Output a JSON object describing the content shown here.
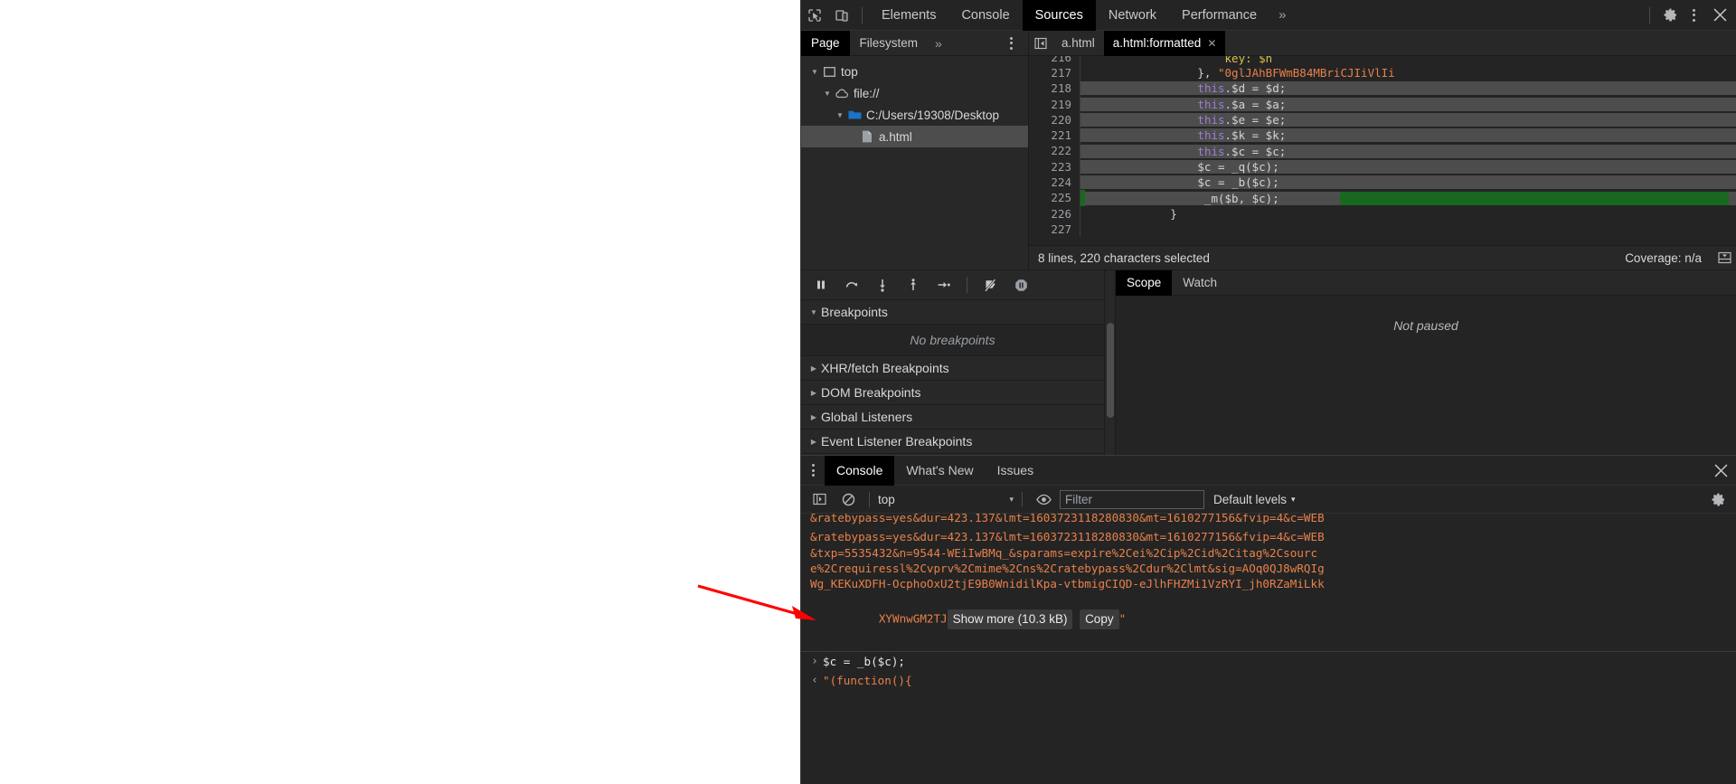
{
  "devtools": {
    "main_tabs": [
      {
        "label": "Elements",
        "active": false
      },
      {
        "label": "Console",
        "active": false
      },
      {
        "label": "Sources",
        "active": true
      },
      {
        "label": "Network",
        "active": false
      },
      {
        "label": "Performance",
        "active": false
      }
    ],
    "more_tabs_label": "»",
    "inspect_icon": "inspect-cursor-icon",
    "device_icon": "device-toolbar-icon",
    "settings_icon": "gear-icon",
    "menu_icon": "kebab-menu-icon",
    "close_icon": "close-icon"
  },
  "navigator": {
    "tabs": [
      {
        "label": "Page",
        "active": true
      },
      {
        "label": "Filesystem",
        "active": false
      }
    ],
    "more_label": "»",
    "tree": [
      {
        "label": "top",
        "icon": "frame-icon",
        "depth": 0,
        "expanded": true,
        "selected": false
      },
      {
        "label": "file://",
        "icon": "cloud-icon",
        "depth": 1,
        "expanded": true,
        "selected": false
      },
      {
        "label": "C:/Users/19308/Desktop",
        "icon": "folder-icon",
        "depth": 2,
        "expanded": true,
        "selected": false
      },
      {
        "label": "a.html",
        "icon": "file-icon",
        "depth": 3,
        "expanded": false,
        "selected": true
      }
    ]
  },
  "editor": {
    "back_icon": "navigate-back-icon",
    "tabs": [
      {
        "label": "a.html",
        "active": false,
        "closeable": false
      },
      {
        "label": "a.html:formatted",
        "active": true,
        "closeable": true
      }
    ],
    "close_icon": "close-icon",
    "lines": [
      {
        "num": "216",
        "partial": true,
        "selected": false,
        "segments": [
          {
            "t": "                    key: $n",
            "c": "tok-yel"
          }
        ]
      },
      {
        "num": "217",
        "selected": false,
        "green_tail": false,
        "segments": [
          {
            "t": "                }, ",
            "c": "tok-plain"
          },
          {
            "t": "\"0glJAhBFWmB84MBriCJIiVlIi",
            "c": "tok-str"
          }
        ]
      },
      {
        "num": "218",
        "selected": true,
        "green_tail": false,
        "segments": [
          {
            "t": "                ",
            "c": "tok-plain"
          },
          {
            "t": "this",
            "c": "tok-kw"
          },
          {
            "t": ".$d = $d;",
            "c": "tok-plain"
          }
        ]
      },
      {
        "num": "219",
        "selected": true,
        "green_tail": false,
        "segments": [
          {
            "t": "                ",
            "c": "tok-plain"
          },
          {
            "t": "this",
            "c": "tok-kw"
          },
          {
            "t": ".$a = $a;",
            "c": "tok-plain"
          }
        ]
      },
      {
        "num": "220",
        "selected": true,
        "green_tail": false,
        "segments": [
          {
            "t": "                ",
            "c": "tok-plain"
          },
          {
            "t": "this",
            "c": "tok-kw"
          },
          {
            "t": ".$e = $e;",
            "c": "tok-plain"
          }
        ]
      },
      {
        "num": "221",
        "selected": true,
        "green_tail": false,
        "segments": [
          {
            "t": "                ",
            "c": "tok-plain"
          },
          {
            "t": "this",
            "c": "tok-kw"
          },
          {
            "t": ".$k = $k;",
            "c": "tok-plain"
          }
        ]
      },
      {
        "num": "222",
        "selected": true,
        "green_tail": false,
        "segments": [
          {
            "t": "                ",
            "c": "tok-plain"
          },
          {
            "t": "this",
            "c": "tok-kw"
          },
          {
            "t": ".$c = $c;",
            "c": "tok-plain"
          }
        ]
      },
      {
        "num": "223",
        "selected": true,
        "green_tail": false,
        "segments": [
          {
            "t": "                $c = _q($c);",
            "c": "tok-plain"
          }
        ]
      },
      {
        "num": "224",
        "selected": true,
        "green_tail": false,
        "segments": [
          {
            "t": "                $c = _b($c);",
            "c": "tok-plain"
          }
        ]
      },
      {
        "num": "225",
        "selected": true,
        "green_tail": true,
        "breakpoint": true,
        "segments": [
          {
            "t": "                 _m($b, $c);",
            "c": "tok-plain"
          }
        ]
      },
      {
        "num": "226",
        "selected": false,
        "green_tail": false,
        "segments": [
          {
            "t": "            }",
            "c": "tok-plain"
          }
        ]
      },
      {
        "num": "227",
        "selected": false,
        "green_tail": false,
        "segments": [
          {
            "t": "",
            "c": "tok-plain"
          }
        ]
      }
    ],
    "status": {
      "selection": "8 lines, 220 characters selected",
      "coverage": "Coverage: n/a",
      "drawer_icon": "show-drawer-icon"
    }
  },
  "debugger": {
    "toolbar_buttons": [
      {
        "name": "pause-resume-button",
        "icon": "pause-icon"
      },
      {
        "name": "step-over-button",
        "icon": "step-over-icon"
      },
      {
        "name": "step-into-button",
        "icon": "step-into-icon"
      },
      {
        "name": "step-out-button",
        "icon": "step-out-icon"
      },
      {
        "name": "step-button",
        "icon": "step-icon"
      },
      {
        "name": "deactivate-breakpoints-button",
        "icon": "deactivate-breakpoints-icon"
      },
      {
        "name": "pause-on-exceptions-button",
        "icon": "pause-on-exceptions-icon"
      }
    ],
    "sections": [
      {
        "label": "Breakpoints",
        "expanded": true
      },
      {
        "label": "XHR/fetch Breakpoints",
        "expanded": false
      },
      {
        "label": "DOM Breakpoints",
        "expanded": false
      },
      {
        "label": "Global Listeners",
        "expanded": false
      },
      {
        "label": "Event Listener Breakpoints",
        "expanded": false
      }
    ],
    "no_breakpoints": "No breakpoints",
    "side_tabs": [
      {
        "label": "Scope",
        "active": true
      },
      {
        "label": "Watch",
        "active": false
      }
    ],
    "not_paused": "Not paused"
  },
  "drawer": {
    "menu_icon": "kebab-menu-icon",
    "tabs": [
      {
        "label": "Console",
        "active": true
      },
      {
        "label": "What's New",
        "active": false
      },
      {
        "label": "Issues",
        "active": false
      }
    ],
    "close_icon": "close-icon",
    "toolbar": {
      "sidebar_icon": "console-sidebar-icon",
      "clear_icon": "clear-console-icon",
      "context": "top",
      "context_caret": "▾",
      "eye_icon": "live-expression-icon",
      "filter_placeholder": "Filter",
      "filter_value": "",
      "levels_label": "Default levels",
      "levels_caret": "▾",
      "settings_icon": "gear-icon"
    },
    "output": {
      "url_lines": [
        "&ratebypass=yes&dur=423.137&lmt=1603723118280830&mt=1610277156&fvip=4&c=WEB",
        "&txp=5535432&n=9544-WEiIwBMq_&sparams=expire%2Cei%2Cip%2Cid%2Citag%2Csourc",
        "e%2Crequiressl%2Cvprv%2Cmime%2Cns%2Cratebypass%2Cdur%2Clmt&sig=AOq0QJ8wRQIg",
        "Wg_KEKuXDFH-OcphoOxU2tjE9B0WnidilKpa-vtbmigCIQD-eJlhFHZMi1VzRYI_jh0RZaMiLkk"
      ],
      "tail_text": "XYWnwGM2TJ",
      "show_more_label": "Show more (10.3 kB)",
      "copy_label": "Copy",
      "closing_quote": "\"",
      "prompt_marker": "›",
      "prompt_text": "$c = _b($c);",
      "result_marker": "‹",
      "result_text": "\"(function(){"
    }
  },
  "annotation": {
    "arrow_color": "#ff0000",
    "arrow_name": "red-pointer-arrow"
  }
}
